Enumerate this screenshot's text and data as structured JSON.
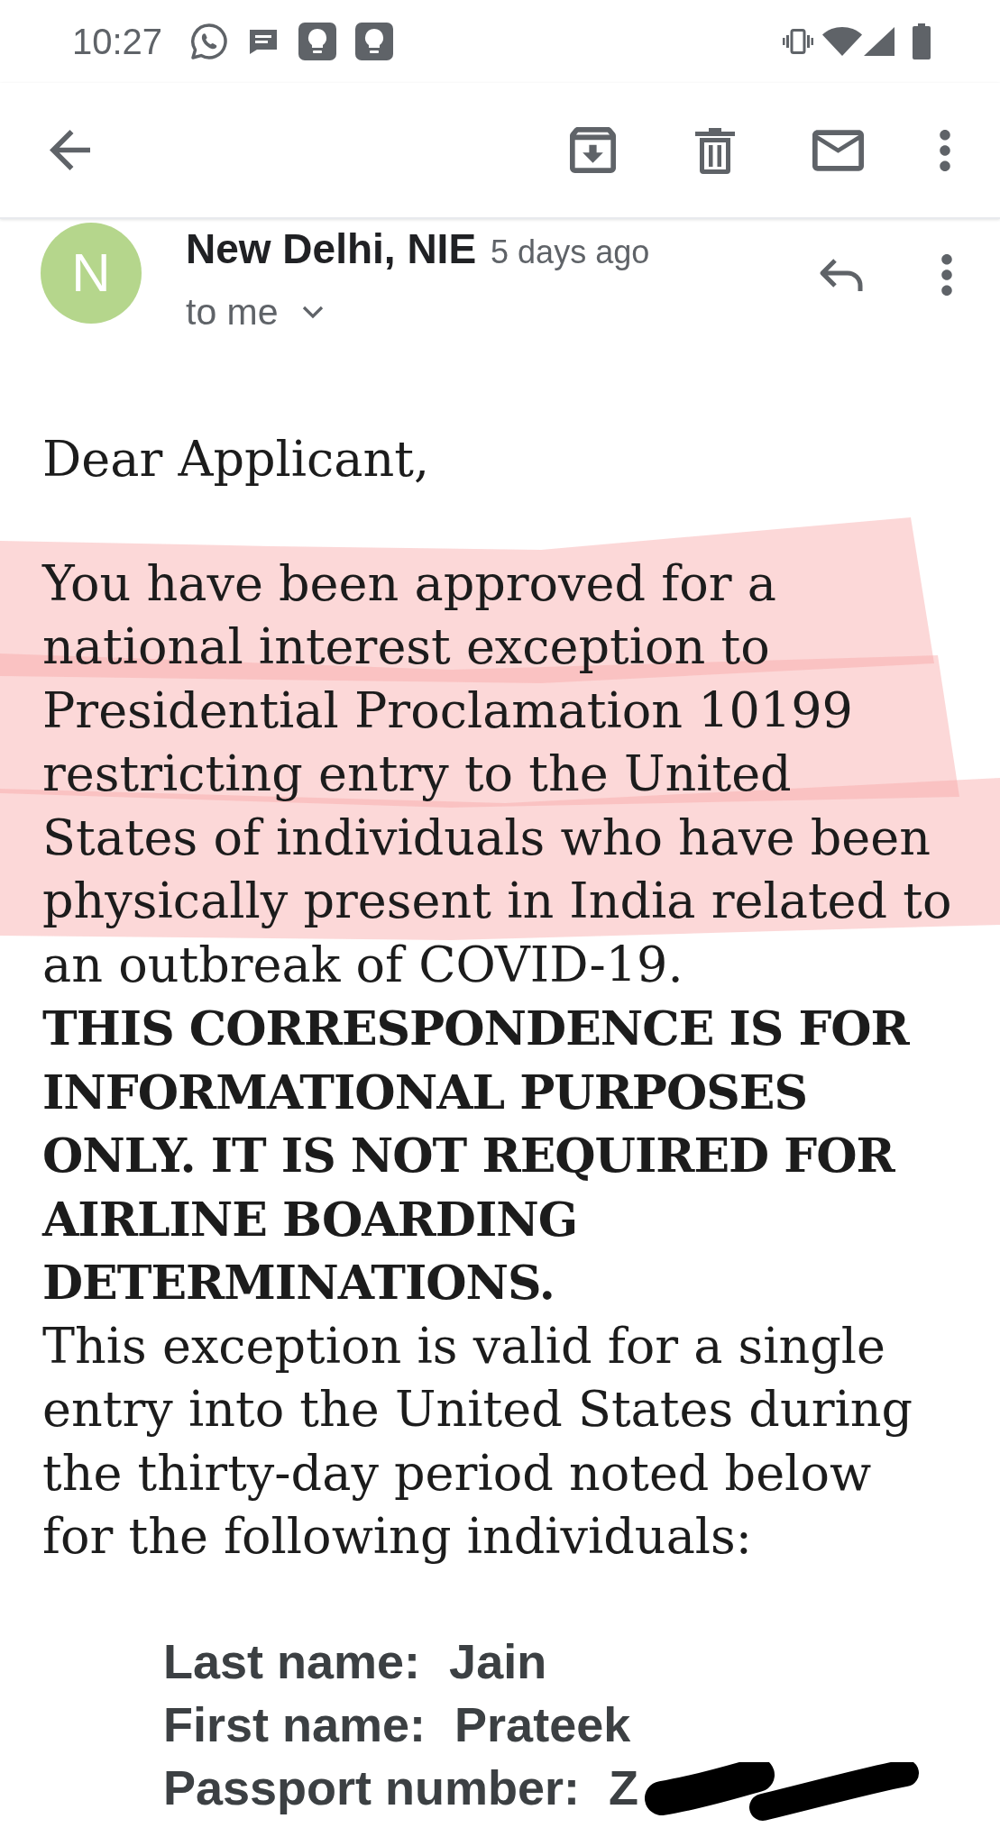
{
  "status_bar": {
    "time": "10:27"
  },
  "message": {
    "avatar_letter": "N",
    "sender": "New Delhi, NIE",
    "time": "5 days ago",
    "recipient": "to me"
  },
  "body": {
    "greeting": "Dear Applicant,",
    "paragraphs": [
      {
        "kind": "plain",
        "highlighted": true,
        "text": "You have been approved for a national interest exception to Presidential Proclamation 10199 restricting entry to the United States of individuals who have been physically present in India related to an outbreak of COVID-19."
      },
      {
        "kind": "bold",
        "highlighted": false,
        "text": "THIS CORRESPONDENCE IS FOR INFORMATIONAL PURPOSES ONLY. IT IS NOT REQUIRED FOR AIRLINE BOARDING DETERMINATIONS."
      },
      {
        "kind": "plain",
        "highlighted": false,
        "text": "This exception is valid for a single entry into the United States during the thirty-day period noted below for the following individuals:"
      }
    ],
    "details": [
      {
        "label": "Last name:",
        "value": "Jain",
        "redacted": false
      },
      {
        "label": "First name:",
        "value": "Prateek",
        "redacted": false
      },
      {
        "label": "Passport number:",
        "value": "Z",
        "redacted": true
      }
    ]
  }
}
